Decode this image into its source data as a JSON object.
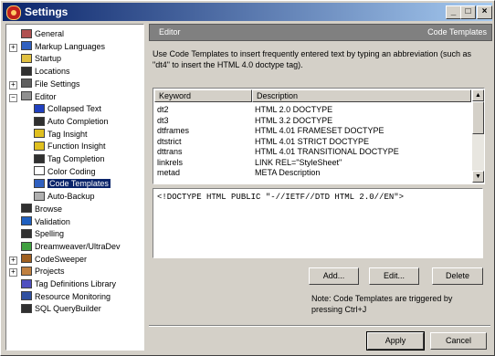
{
  "window": {
    "title": "Settings",
    "min_label": "_",
    "max_label": "□",
    "close_label": "×"
  },
  "tree": {
    "items": [
      {
        "label": "General",
        "icon": "general-icon",
        "color": "#b05050"
      },
      {
        "label": "Markup Languages",
        "icon": "markup-icon",
        "color": "#3060c0",
        "expander": "+"
      },
      {
        "label": "Startup",
        "icon": "folder-icon",
        "color": "#e0c040"
      },
      {
        "label": "Locations",
        "icon": "locations-icon",
        "color": "#303030"
      },
      {
        "label": "File Settings",
        "icon": "file-settings-icon",
        "color": "#606060",
        "expander": "+"
      },
      {
        "label": "Editor",
        "icon": "editor-icon",
        "color": "#909090",
        "expander": "−"
      },
      {
        "label": "Collapsed Text",
        "icon": "collapsed-text-icon",
        "color": "#2040c0"
      },
      {
        "label": "Auto Completion",
        "icon": "auto-completion-icon",
        "color": "#303030"
      },
      {
        "label": "Tag Insight",
        "icon": "bulb-icon",
        "color": "#e0c020"
      },
      {
        "label": "Function Insight",
        "icon": "bulb-icon",
        "color": "#e0c020"
      },
      {
        "label": "Tag Completion",
        "icon": "tag-completion-icon",
        "color": "#303030"
      },
      {
        "label": "Color Coding",
        "icon": "color-coding-icon",
        "color": "#ffffff"
      },
      {
        "label": "Code Templates",
        "icon": "code-templates-icon",
        "color": "#3060c0",
        "selected": true
      },
      {
        "label": "Auto-Backup",
        "icon": "auto-backup-icon",
        "color": "#b0b0b0"
      },
      {
        "label": "Browse",
        "icon": "browse-icon",
        "color": "#303030"
      },
      {
        "label": "Validation",
        "icon": "validation-icon",
        "color": "#2060c0"
      },
      {
        "label": "Spelling",
        "icon": "spelling-icon",
        "color": "#303030"
      },
      {
        "label": "Dreamweaver/UltraDev",
        "icon": "dreamweaver-icon",
        "color": "#40a040"
      },
      {
        "label": "CodeSweeper",
        "icon": "codesweeper-icon",
        "color": "#a06020",
        "expander": "+"
      },
      {
        "label": "Projects",
        "icon": "projects-icon",
        "color": "#c08040",
        "expander": "+"
      },
      {
        "label": "Tag Definitions Library",
        "icon": "tag-definitions-icon",
        "color": "#5050c0"
      },
      {
        "label": "Resource Monitoring",
        "icon": "resource-monitoring-icon",
        "color": "#3050a0"
      },
      {
        "label": "SQL QueryBuilder",
        "icon": "sql-querybuilder-icon",
        "color": "#303030"
      }
    ]
  },
  "panel": {
    "header_left": "Editor",
    "header_right": "Code Templates",
    "description": "Use Code Templates to insert frequently entered text by typing an abbreviation (such as \"dt4\" to insert the HTML 4.0 doctype tag).",
    "columns": [
      "Keyword",
      "Description"
    ],
    "rows": [
      {
        "keyword": "dt2",
        "description": "HTML 2.0 DOCTYPE"
      },
      {
        "keyword": "dt3",
        "description": "HTML 3.2 DOCTYPE"
      },
      {
        "keyword": "dtframes",
        "description": "HTML 4.01 FRAMESET DOCTYPE"
      },
      {
        "keyword": "dtstrict",
        "description": "HTML 4.01 STRICT DOCTYPE"
      },
      {
        "keyword": "dttrans",
        "description": "HTML 4.01 TRANSITIONAL DOCTYPE"
      },
      {
        "keyword": "linkrels",
        "description": "LINK REL=\"StyleSheet\""
      },
      {
        "keyword": "metad",
        "description": "META Description"
      }
    ],
    "code_text": "<!DOCTYPE HTML PUBLIC \"-//IETF//DTD HTML 2.0//EN\">",
    "add_label": "Add...",
    "edit_label": "Edit...",
    "delete_label": "Delete",
    "note": "Note: Code Templates are triggered by pressing Ctrl+J"
  },
  "footer": {
    "apply_label": "Apply",
    "cancel_label": "Cancel"
  }
}
